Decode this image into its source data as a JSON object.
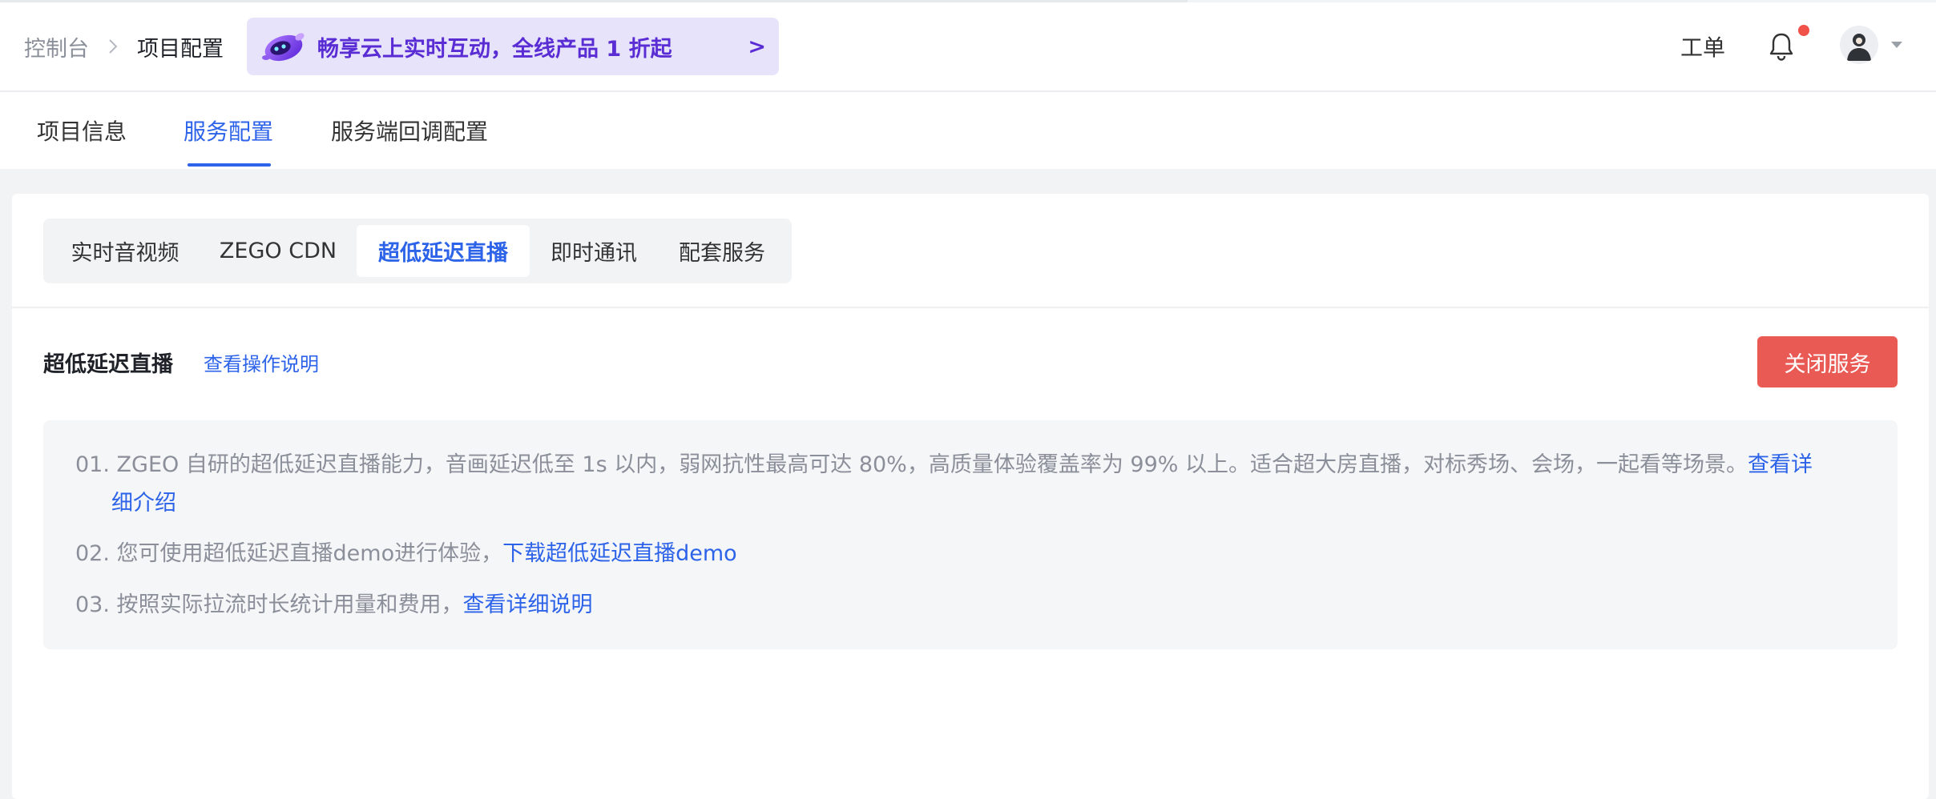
{
  "breadcrumb": {
    "root": "控制台",
    "current": "项目配置"
  },
  "promo": {
    "text": "畅享云上实时互动，全线产品 1 折起",
    "arrow": ">"
  },
  "header": {
    "ticket_label": "工单",
    "has_notification": true
  },
  "main_tabs": [
    {
      "label": "项目信息",
      "active": false
    },
    {
      "label": "服务配置",
      "active": true
    },
    {
      "label": "服务端回调配置",
      "active": false
    }
  ],
  "sub_tabs": [
    {
      "label": "实时音视频",
      "active": false
    },
    {
      "label": "ZEGO CDN",
      "active": false
    },
    {
      "label": "超低延迟直播",
      "active": true
    },
    {
      "label": "即时通讯",
      "active": false
    },
    {
      "label": "配套服务",
      "active": false
    }
  ],
  "section": {
    "title": "超低延迟直播",
    "help_link": "查看操作说明",
    "close_button": "关闭服务"
  },
  "descriptions": [
    {
      "text": "01. ZGEO 自研的超低延迟直播能力，音画延迟低至 1s 以内，弱网抗性最高可达 80%，高质量体验覆盖率为 99% 以上。适合超大房直播，对标秀场、会场，一起看等场景。",
      "link_line1": "查看详",
      "link_line2": "细介绍"
    },
    {
      "text": "02. 您可使用超低延迟直播demo进行体验，",
      "link": "下载超低延迟直播demo"
    },
    {
      "text": "03. 按照实际拉流时长统计用量和费用，",
      "link": "查看详细说明"
    }
  ],
  "colors": {
    "accent": "#2c63e8",
    "danger": "#ea5a55",
    "promo_bg": "#e6e3fb",
    "promo_text": "#5a2dd4",
    "notification_dot": "#f0524a"
  }
}
